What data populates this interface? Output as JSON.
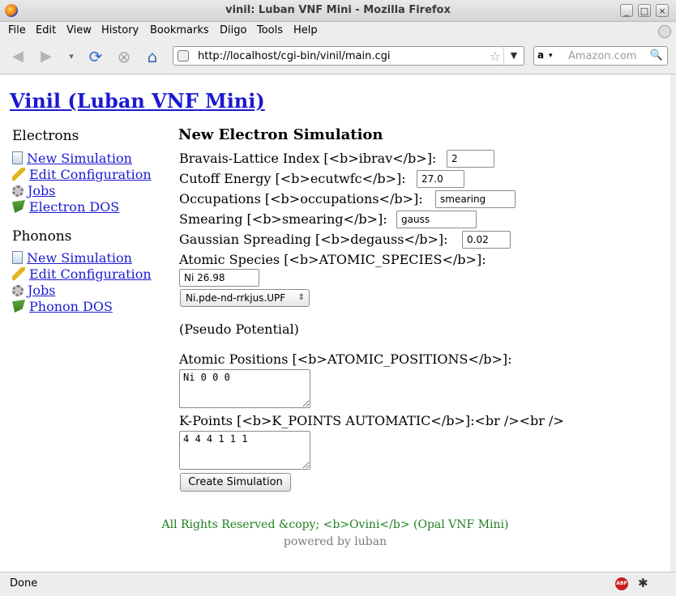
{
  "window": {
    "title": "vinil: Luban VNF Mini - Mozilla Firefox",
    "controls": {
      "minimize": "_",
      "maximize": "□",
      "close": "×"
    }
  },
  "menu": [
    "File",
    "Edit",
    "View",
    "History",
    "Bookmarks",
    "Diigo",
    "Tools",
    "Help"
  ],
  "menu_mnemonic": [
    "F",
    "E",
    "V",
    "H",
    "B",
    "",
    "T",
    "H"
  ],
  "toolbar": {
    "url": "http://localhost/cgi-bin/vinil/main.cgi",
    "search_placeholder": "Amazon.com",
    "search_engine": "a"
  },
  "page": {
    "heading": "Vinil (Luban VNF Mini)",
    "sidebar": {
      "electrons_title": "Electrons",
      "electrons_items": [
        {
          "label": "New Simulation",
          "icon": "document-icon"
        },
        {
          "label": "Edit Configuration",
          "icon": "pencil-icon"
        },
        {
          "label": "Jobs",
          "icon": "gear-icon"
        },
        {
          "label": "Electron DOS",
          "icon": "flag-icon"
        }
      ],
      "phonons_title": "Phonons",
      "phonons_items": [
        {
          "label": "New Simulation",
          "icon": "document-icon"
        },
        {
          "label": "Edit Configuration",
          "icon": "pencil-icon"
        },
        {
          "label": "Jobs",
          "icon": "gear-icon"
        },
        {
          "label": "Phonon DOS",
          "icon": "flag-icon"
        }
      ]
    },
    "form": {
      "title": "New Electron Simulation",
      "ibrav_label": "Bravais-Lattice Index [<b>ibrav</b>]:",
      "ibrav_value": "2",
      "ecutwfc_label": "Cutoff Energy [<b>ecutwfc</b>]:",
      "ecutwfc_value": "27.0",
      "occupations_label": "Occupations [<b>occupations</b>]:",
      "occupations_value": "smearing",
      "smearing_label": "Smearing [<b>smearing</b>]:",
      "smearing_value": "gauss",
      "degauss_label": "Gaussian Spreading [<b>degauss</b>]:",
      "degauss_value": "0.02",
      "species_label": "Atomic Species [<b>ATOMIC_SPECIES</b>]:",
      "species_value": "Ni 26.98",
      "pseudo_select": "Ni.pde-nd-rrkjus.UPF",
      "pseudo_note": "(Pseudo Potential)",
      "positions_label": "Atomic Positions [<b>ATOMIC_POSITIONS</b>]:",
      "positions_value": "Ni 0 0 0",
      "kpoints_label": "K-Points [<b>K_POINTS AUTOMATIC</b>]:<br /><br />",
      "kpoints_value": "4 4 4 1 1 1",
      "submit": "Create Simulation"
    },
    "footer_rights": "All Rights Reserved &copy; <b>Ovini</b> (Opal VNF Mini)",
    "footer_powered": "powered by luban"
  },
  "status": {
    "text": "Done"
  }
}
